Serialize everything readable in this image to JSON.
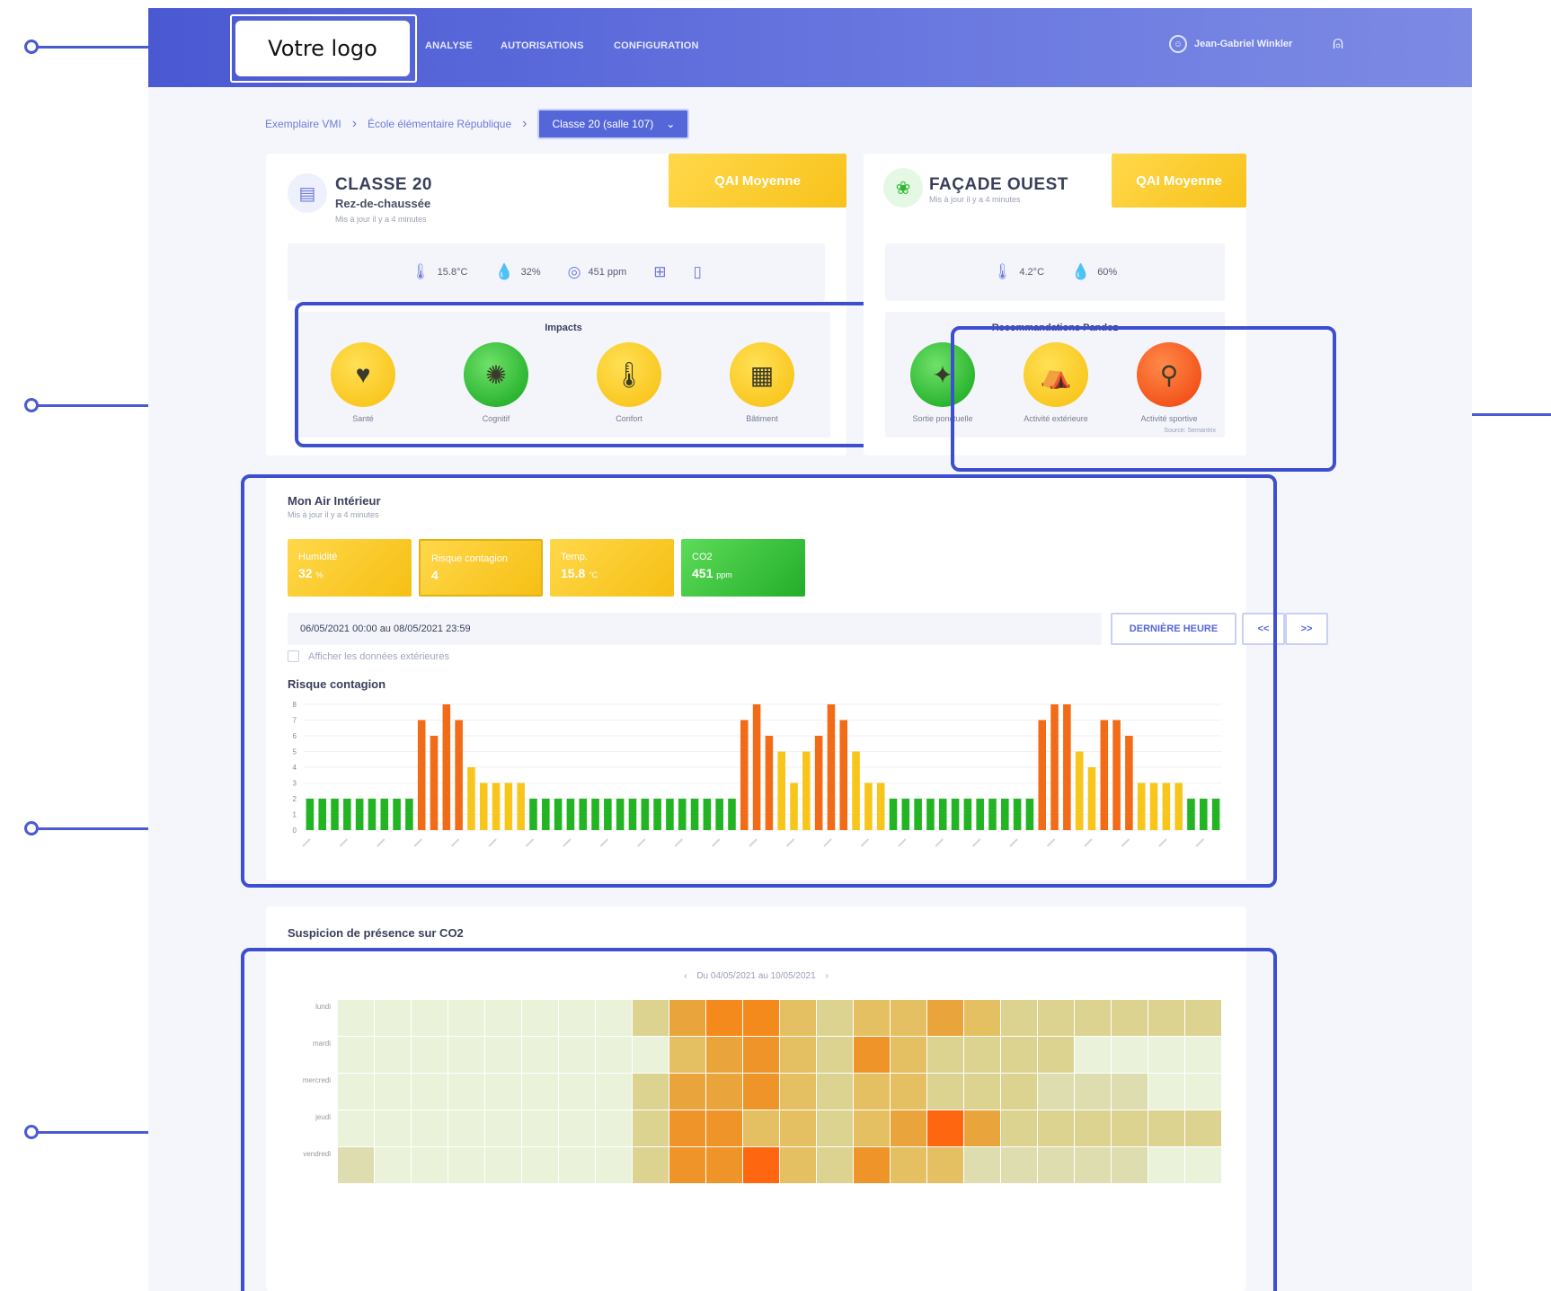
{
  "header": {
    "logo_text": "Votre logo",
    "nav": [
      "ANALYSE",
      "AUTORISATIONS",
      "CONFIGURATION"
    ],
    "user_name": "Jean-Gabriel Winkler",
    "user_icon": "user-circle-icon",
    "logout_icon": "logout-icon"
  },
  "breadcrumb": {
    "items": [
      "Exemplaire VMI",
      "École élémentaire République"
    ],
    "selected": "Classe 20 (salle 107)"
  },
  "classe_card": {
    "title": "CLASSE 20",
    "subtitle": "Rez-de-chaussée",
    "updated": "Mis à jour il y a 4 minutes",
    "qai_label": "QAI Moyenne",
    "metrics": [
      {
        "icon": "thermometer-icon",
        "value": "15.8°C"
      },
      {
        "icon": "droplet-icon",
        "value": "32%"
      },
      {
        "icon": "co2-icon",
        "value": "451 ppm"
      },
      {
        "icon": "window-icon",
        "value": ""
      },
      {
        "icon": "door-icon",
        "value": ""
      }
    ],
    "impacts_title": "Impacts",
    "impacts": [
      {
        "label": "Santé",
        "color": "yellow",
        "icon": "health-icon"
      },
      {
        "label": "Cognitif",
        "color": "green",
        "icon": "brain-icon"
      },
      {
        "label": "Confort",
        "color": "yellow",
        "icon": "thermometer-icon"
      },
      {
        "label": "Bâtiment",
        "color": "yellow",
        "icon": "building-icon"
      }
    ]
  },
  "facade_card": {
    "title": "FAÇADE OUEST",
    "updated": "Mis à jour il y a 4 minutes",
    "qai_label": "QAI Moyenne",
    "metrics": [
      {
        "icon": "thermometer-icon",
        "value": "4.2°C"
      },
      {
        "icon": "droplet-icon",
        "value": "60%"
      }
    ],
    "reco_title": "Recommandations Pandoz",
    "recommendations": [
      {
        "label": "Sortie ponctuelle",
        "color": "green",
        "icon": "walking-icon"
      },
      {
        "label": "Activité extérieure",
        "color": "yellow",
        "icon": "outdoor-icon"
      },
      {
        "label": "Activité sportive",
        "color": "orange",
        "icon": "bike-icon"
      }
    ],
    "footnote": "Source: Semantrix"
  },
  "air": {
    "title": "Mon Air Intérieur",
    "updated": "Mis à jour il y a 4 minutes",
    "tiles": [
      {
        "label": "Humidité",
        "value": "32",
        "unit": "%",
        "color": "y"
      },
      {
        "label": "Risque contagion",
        "value": "4",
        "unit": "",
        "color": "y"
      },
      {
        "label": "Temp.",
        "value": "15.8",
        "unit": "°C",
        "color": "y"
      },
      {
        "label": "CO2",
        "value": "451",
        "unit": "ppm",
        "color": "g"
      }
    ],
    "date_range": "06/05/2021 00:00 au 08/05/2021 23:59",
    "last_hour_button": "DERNIÈRE HEURE",
    "prev_button": "<<",
    "next_button": ">>",
    "checkbox_label": "Afficher les données extérieures",
    "chart_title": "Risque contagion"
  },
  "presence": {
    "title": "Suspicion de présence sur CO2",
    "range": "Du 04/05/2021 au 10/05/2021",
    "days": [
      "lundi",
      "mardi",
      "mercredi",
      "jeudi",
      "vendredi"
    ]
  },
  "colors": {
    "brand": "#4a59d2",
    "green": "#22b422",
    "yellow": "#f8c61b",
    "orange": "#f26b16",
    "red_orange": "#f2540c"
  },
  "chart_data": {
    "type": "bar",
    "title": "Risque contagion",
    "xlabel": "",
    "ylabel": "",
    "ylim": [
      0,
      8
    ],
    "y_ticks": [
      0,
      1,
      2,
      3,
      4,
      5,
      6,
      7,
      8
    ],
    "values": [
      2,
      2,
      2,
      2,
      2,
      2,
      2,
      2,
      2,
      7,
      6,
      8,
      7,
      4,
      3,
      3,
      3,
      3,
      2,
      2,
      2,
      2,
      2,
      2,
      2,
      2,
      2,
      2,
      2,
      2,
      2,
      2,
      2,
      2,
      2,
      7,
      8,
      6,
      5,
      3,
      5,
      6,
      8,
      7,
      5,
      3,
      3,
      2,
      2,
      2,
      2,
      2,
      2,
      2,
      2,
      2,
      2,
      2,
      2,
      7,
      8,
      8,
      5,
      4,
      7,
      7,
      6,
      3,
      3,
      3,
      3,
      2,
      2,
      2
    ],
    "color_by_value": {
      "2": "#22b422",
      "3": "#f8c61b",
      "4": "#f8c61b",
      "5": "#f8c61b",
      "6": "#f26b16",
      "7": "#f26b16",
      "8": "#f26b16"
    }
  },
  "heatmap_data": {
    "type": "heatmap",
    "rows": [
      "lundi",
      "mardi",
      "mercredi",
      "jeudi",
      "vendredi"
    ],
    "cols": 24,
    "values": [
      [
        1,
        1,
        1,
        1,
        1,
        1,
        1,
        1,
        3,
        5,
        7,
        7,
        4,
        3,
        4,
        4,
        5,
        4,
        3,
        3,
        3,
        3,
        3,
        3
      ],
      [
        1,
        1,
        1,
        1,
        1,
        1,
        1,
        1,
        1,
        4,
        5,
        6,
        4,
        3,
        6,
        4,
        3,
        3,
        3,
        3,
        1,
        1,
        1,
        1
      ],
      [
        1,
        1,
        1,
        1,
        1,
        1,
        1,
        1,
        3,
        5,
        5,
        6,
        4,
        3,
        4,
        4,
        3,
        3,
        3,
        2,
        2,
        2,
        1,
        1
      ],
      [
        1,
        1,
        1,
        1,
        1,
        1,
        1,
        1,
        3,
        6,
        6,
        4,
        4,
        3,
        4,
        5,
        8,
        5,
        3,
        3,
        3,
        3,
        3,
        3
      ],
      [
        2,
        1,
        1,
        1,
        1,
        1,
        1,
        1,
        3,
        6,
        6,
        8,
        4,
        3,
        6,
        4,
        4,
        2,
        2,
        2,
        2,
        2,
        1,
        1
      ]
    ]
  }
}
